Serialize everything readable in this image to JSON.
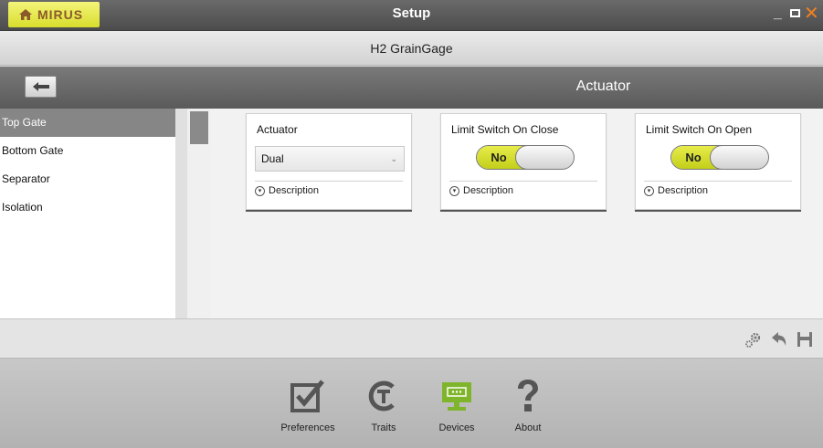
{
  "window": {
    "brand": "MIRUS",
    "title": "Setup",
    "minimize_glyph": "_",
    "close_glyph": "✕"
  },
  "device": {
    "name": "H2 GrainGage"
  },
  "section": {
    "title": "Actuator"
  },
  "sidebar": {
    "items": [
      {
        "label": "Top Gate",
        "selected": true
      },
      {
        "label": "Bottom Gate",
        "selected": false
      },
      {
        "label": "Separator",
        "selected": false
      },
      {
        "label": "Isolation",
        "selected": false
      }
    ]
  },
  "cards": {
    "actuator": {
      "title": "Actuator",
      "value": "Dual",
      "desc_label": "Description"
    },
    "limit_close": {
      "title": "Limit Switch On Close",
      "toggle_label": "No",
      "desc_label": "Description"
    },
    "limit_open": {
      "title": "Limit Switch On Open",
      "toggle_label": "No",
      "desc_label": "Description"
    }
  },
  "toolbar": {
    "icons": [
      "gears-icon",
      "undo-icon",
      "save-icon"
    ]
  },
  "nav": {
    "items": [
      {
        "label": "Preferences",
        "icon": "checkbox-icon",
        "active": false
      },
      {
        "label": "Traits",
        "icon": "traits-icon",
        "active": false
      },
      {
        "label": "Devices",
        "icon": "monitor-icon",
        "active": true
      },
      {
        "label": "About",
        "icon": "question-icon",
        "active": false
      }
    ]
  },
  "colors": {
    "accent": "#d6df26",
    "close": "#f08020",
    "active_nav": "#7fb52a"
  }
}
